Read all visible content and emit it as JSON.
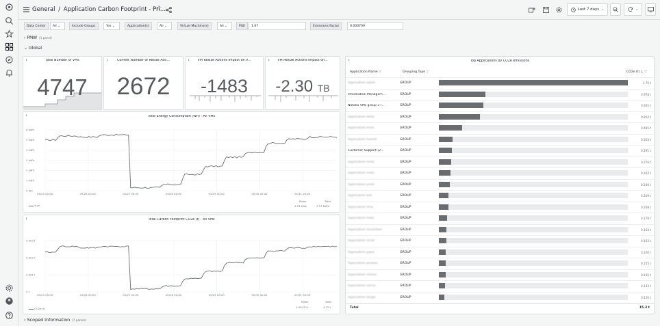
{
  "breadcrumb": {
    "home": "General",
    "sep": "/",
    "title": "Application Carbon Footprint - Pri..."
  },
  "timepicker": {
    "label": "Last 7 days"
  },
  "variables": [
    {
      "label": "Data Center",
      "value": "All"
    },
    {
      "label": "Include Groups",
      "value": "Yes"
    },
    {
      "label": "Application(s)",
      "value": "All"
    },
    {
      "label": "Virtual Machine(s)",
      "value": "All"
    },
    {
      "label": "PUE",
      "value": "1.67"
    },
    {
      "label": "Emissions Factor",
      "value": "0.000709"
    }
  ],
  "rows": {
    "pmw": {
      "title": "PMW",
      "sub": "(1 panel)"
    },
    "global": {
      "title": "Global"
    },
    "scoped": {
      "title": "Scoped Information",
      "sub": "(7 panels)"
    }
  },
  "stats": [
    {
      "title": "Total Number of VMs",
      "value": "4747"
    },
    {
      "title": "Current Number of Resize Acti...",
      "value": "2672"
    },
    {
      "title": "VM Resize Actions Impact on V...",
      "value": "-1483",
      "unit": ""
    },
    {
      "title": "VM Resize Actions Impact on...",
      "value": "-2.30",
      "unit": "TB"
    }
  ],
  "energy_chart": {
    "title": "Total Energy Consumption (Wh) - All VMs",
    "y_ticks": [
      "6 kWh",
      "5 kWh",
      "4 kWh",
      "3 kWh",
      "2 kWh",
      "1 kWh",
      "0 Wh"
    ],
    "x_ticks": [
      "05/25 00:00",
      "05/26 00:00",
      "05/27 00:00",
      "05/28 00:00",
      "05/29 00:00",
      "05/30 00:00",
      "05/31 00:00"
    ],
    "legend": {
      "name": "sum",
      "mean_label": "Mean",
      "total_label": "Total",
      "mean": "4.03 kWh",
      "total": "3.57 MWh"
    }
  },
  "carbon_chart": {
    "title": "Total Carbon Footprint CO2e (t) - All VMs",
    "y_ticks": [
      "0.003 t",
      "0.002 t",
      "0.001 t",
      "0 t"
    ],
    "x_ticks": [
      "05/25 00:00",
      "05/26 00:00",
      "05/27 00:00",
      "05/28 00:00",
      "05/29 00:00",
      "05/30 00:00",
      "05/31 00:00"
    ],
    "legend": {
      "name": "CO2e (t)",
      "mean_label": "Mean",
      "total_label": "Total",
      "mean": "0.00470 t",
      "total": "4.23 t"
    }
  },
  "chart_data": [
    {
      "type": "line",
      "title": "Total Energy Consumption (Wh) - All VMs",
      "ylabel": "",
      "xlabel": "",
      "ylim": [
        0,
        6
      ],
      "x": [
        "05/25 00:00",
        "05/25 12:00",
        "05/26 00:00",
        "05/26 12:00",
        "05/27 00:00",
        "05/27 04:00",
        "05/27 12:00",
        "05/28 00:00",
        "05/28 12:00",
        "05/29 00:00",
        "05/29 12:00",
        "05/30 00:00",
        "05/30 12:00",
        "05/31 00:00",
        "05/31 12:00"
      ],
      "series": [
        {
          "name": "sum",
          "values": [
            5.0,
            5.4,
            5.3,
            5.5,
            5.5,
            0.3,
            0.6,
            1.6,
            2.4,
            3.3,
            3.8,
            4.7,
            5.1,
            5.3,
            5.3
          ]
        }
      ]
    },
    {
      "type": "line",
      "title": "Total Carbon Footprint CO2e (t) - All VMs",
      "ylabel": "",
      "xlabel": "",
      "ylim": [
        0,
        0.0035
      ],
      "x": [
        "05/25 00:00",
        "05/25 12:00",
        "05/26 00:00",
        "05/26 12:00",
        "05/27 00:00",
        "05/27 04:00",
        "05/27 12:00",
        "05/28 00:00",
        "05/28 12:00",
        "05/29 00:00",
        "05/29 12:00",
        "05/30 00:00",
        "05/30 12:00",
        "05/31 00:00",
        "05/31 12:00"
      ],
      "series": [
        {
          "name": "CO2e (t)",
          "values": [
            0.0027,
            0.0031,
            0.003,
            0.0031,
            0.0031,
            0.0002,
            0.0004,
            0.0009,
            0.0014,
            0.002,
            0.0023,
            0.0028,
            0.003,
            0.0031,
            0.0031
          ]
        }
      ]
    },
    {
      "type": "bar",
      "title": "Top Applications by CO2e emissions",
      "categories": [
        "(obscured)",
        "Information Managem...",
        "Natalia VMs group 3 (...",
        "(obscured)",
        "(obscured)",
        "(obscured)",
        "Customer Support (2...",
        "(obscured)",
        "(obscured)",
        "(obscured)",
        "(obscured)",
        "(obscured)",
        "(obscured)",
        "(obscured)",
        "(obscured)",
        "(obscured)",
        "(obscured)",
        "(obscured)",
        "(obscured)",
        "(obscured)"
      ],
      "values": [
        3.76,
        0.978,
        0.935,
        0.854,
        0.485,
        0.303,
        0.291,
        0.276,
        0.262,
        0.24,
        0.209,
        0.208,
        0.178,
        0.164,
        0.163,
        0.16,
        0.155,
        0.145,
        0.133,
        0.126
      ],
      "ylabel": "CO2e (t)"
    }
  ],
  "table": {
    "title": "Top Applications by CO2e emissions",
    "col_name": "Application Name",
    "col_type": "Grouping Type",
    "col_value": "CO2e (t)",
    "total_label": "Total",
    "total_value": "15.3 t",
    "rows": [
      {
        "name": "Application alpha",
        "blur": true,
        "type": "GROUP",
        "value": "3.76 t",
        "frac": 1.0
      },
      {
        "name": "Information Managem...",
        "blur": false,
        "type": "GROUP",
        "value": "0.978 t",
        "frac": 0.245
      },
      {
        "name": "Natalia VMs group 3 (...",
        "blur": false,
        "type": "GROUP",
        "value": "0.935 t",
        "frac": 0.234
      },
      {
        "name": "Application delta",
        "blur": true,
        "type": "GROUP",
        "value": "0.854 t",
        "frac": 0.218
      },
      {
        "name": "Application echo",
        "blur": true,
        "type": "GROUP",
        "value": "0.485 t",
        "frac": 0.124
      },
      {
        "name": "Application foxtrot",
        "blur": true,
        "type": "GROUP",
        "value": "0.303 t",
        "frac": 0.072
      },
      {
        "name": "Customer Support (2...",
        "blur": false,
        "type": "GROUP",
        "value": "0.291 t",
        "frac": 0.07
      },
      {
        "name": "Application hotel",
        "blur": true,
        "type": "GROUP",
        "value": "0.276 t",
        "frac": 0.066
      },
      {
        "name": "Application india",
        "blur": true,
        "type": "GROUP",
        "value": "0.262 t",
        "frac": 0.063
      },
      {
        "name": "Application juliet",
        "blur": true,
        "type": "GROUP",
        "value": "0.240 t",
        "frac": 0.058
      },
      {
        "name": "Application kilo",
        "blur": true,
        "type": "GROUP",
        "value": "0.209 t",
        "frac": 0.05
      },
      {
        "name": "Application lima",
        "blur": true,
        "type": "GROUP",
        "value": "0.208 t",
        "frac": 0.05
      },
      {
        "name": "Application mike",
        "blur": true,
        "type": "GROUP",
        "value": "0.178 t",
        "frac": 0.043
      },
      {
        "name": "Application november",
        "blur": true,
        "type": "GROUP",
        "value": "0.164 t",
        "frac": 0.04
      },
      {
        "name": "Application oscar",
        "blur": true,
        "type": "GROUP",
        "value": "0.163 t",
        "frac": 0.039
      },
      {
        "name": "Application papa",
        "blur": true,
        "type": "GROUP",
        "value": "0.160 t",
        "frac": 0.038
      },
      {
        "name": "Application quebec",
        "blur": true,
        "type": "GROUP",
        "value": "0.155 t",
        "frac": 0.037
      },
      {
        "name": "Application romeo",
        "blur": true,
        "type": "GROUP",
        "value": "0.145 t",
        "frac": 0.035
      },
      {
        "name": "Application sierra",
        "blur": true,
        "type": "GROUP",
        "value": "0.133 t",
        "frac": 0.032
      },
      {
        "name": "Application tango",
        "blur": true,
        "type": "GROUP",
        "value": "0.126 t",
        "frac": 0.03
      }
    ]
  }
}
